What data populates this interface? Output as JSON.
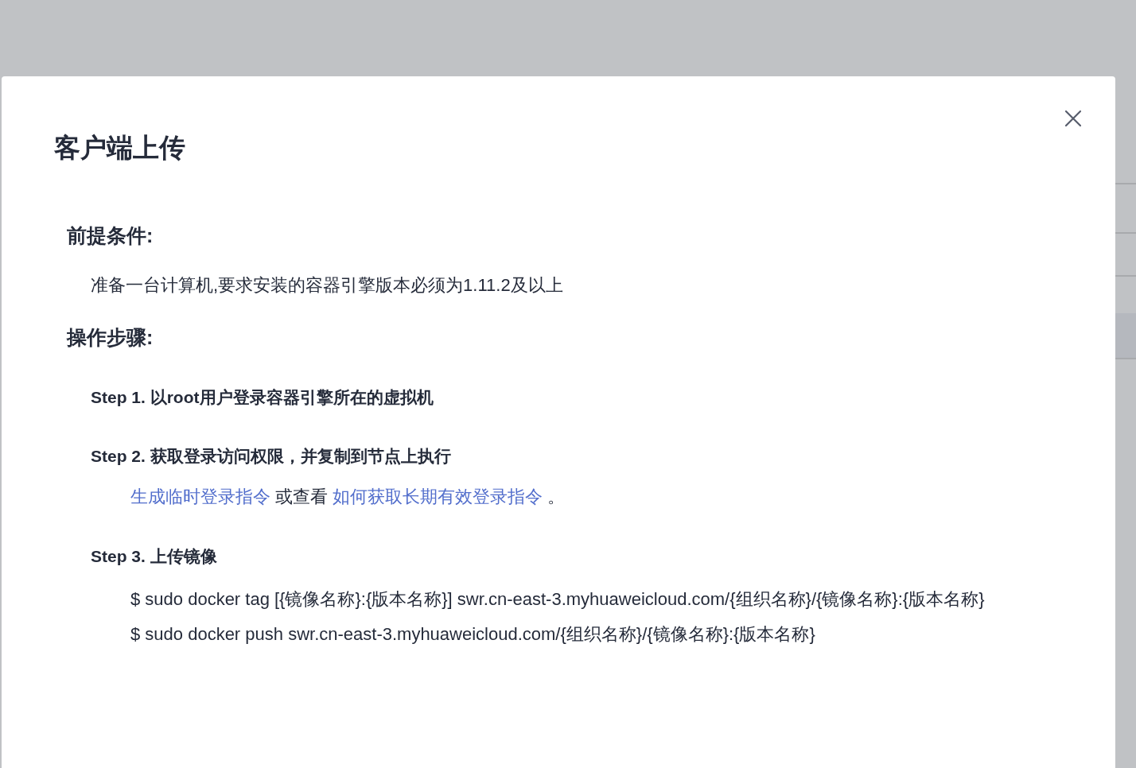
{
  "dialog": {
    "title": "客户端上传"
  },
  "prerequisites": {
    "heading": "前提条件:",
    "text": "准备一台计算机,要求安装的容器引擎版本必须为1.11.2及以上"
  },
  "procedure": {
    "heading": "操作步骤:",
    "steps": [
      {
        "title": "Step 1. 以root用户登录容器引擎所在的虚拟机"
      },
      {
        "title": "Step 2. 获取登录访问权限，并复制到节点上执行",
        "parts": [
          {
            "kind": "link",
            "text": "生成临时登录指令"
          },
          {
            "kind": "text",
            "text": " 或查看 "
          },
          {
            "kind": "link",
            "text": "如何获取长期有效登录指令"
          },
          {
            "kind": "text",
            "text": " 。"
          }
        ]
      },
      {
        "title": "Step 3. 上传镜像",
        "commands": [
          "$ sudo docker tag [{镜像名称}:{版本名称}] swr.cn-east-3.myhuaweicloud.com/{组织名称}/{镜像名称}:{版本名称}",
          "$ sudo docker push swr.cn-east-3.myhuaweicloud.com/{组织名称}/{镜像名称}:{版本名称}"
        ]
      }
    ]
  }
}
